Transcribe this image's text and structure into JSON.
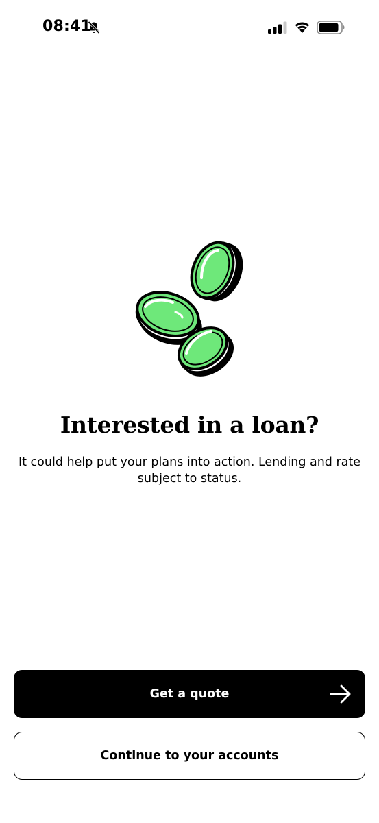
{
  "status_bar": {
    "time": "08:41",
    "icons": [
      "bell-slash-icon",
      "cellular-signal-icon",
      "wifi-icon",
      "battery-icon"
    ]
  },
  "illustration": {
    "name": "coins-icon",
    "accent_color": "#6EE87A"
  },
  "promo": {
    "title": "Interested in a loan?",
    "description": "It could help put your plans into action. Lending and rate subject to status."
  },
  "actions": {
    "primary_label": "Get a quote",
    "primary_icon": "arrow-right-icon",
    "secondary_label": "Continue to your accounts"
  },
  "colors": {
    "primary_button": "#000000",
    "primary_button_text": "#FFFFFF",
    "background": "#FFFFFF"
  }
}
